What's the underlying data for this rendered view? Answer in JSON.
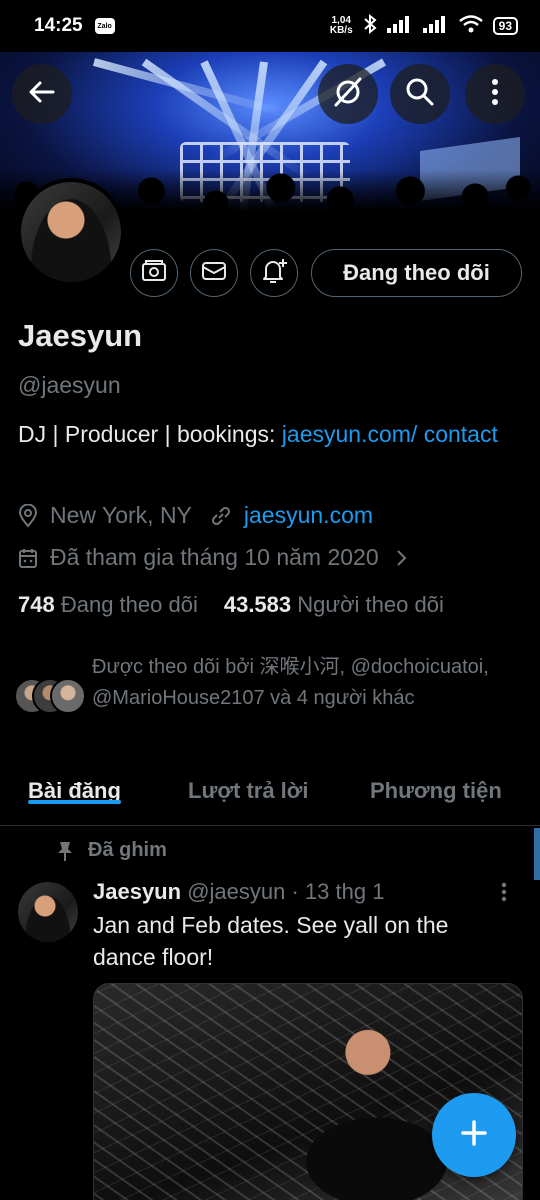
{
  "status_bar": {
    "time": "14:25",
    "notification_app": "Zalo",
    "net_speed_value": "1,04",
    "net_speed_unit": "KB/s",
    "battery": "93"
  },
  "header": {
    "back_icon": "arrow-left-icon",
    "grok_icon": "grok-icon",
    "search_icon": "search-icon",
    "more_icon": "more-vertical-icon"
  },
  "profile": {
    "name": "Jaesyun",
    "handle": "@jaesyun",
    "bio_text": "DJ | Producer | bookings: ",
    "bio_link": "jaesyun.com/ contact",
    "location": "New York, NY",
    "website": "jaesyun.com",
    "joined": "Đã tham gia tháng 10 năm 2020",
    "following_count": "748",
    "following_label": "Đang theo dõi",
    "followers_count": "43.583",
    "followers_label": "Người theo dõi",
    "followed_by": "Được theo dõi bởi 深喉小河, @dochoicuatoi, @MarioHouse2107 và 4 người khác",
    "follow_button": "Đang theo dõi"
  },
  "tabs": [
    {
      "label": "Bài đăng",
      "active": true
    },
    {
      "label": "Lượt trả lời",
      "active": false
    },
    {
      "label": "Phương tiện",
      "active": false
    }
  ],
  "tweet": {
    "pinned_label": "Đã ghim",
    "author": "Jaesyun",
    "handle": "@jaesyun",
    "time": "· 13 thg 1",
    "text": "Jan and Feb dates. See yall on the dance floor!"
  },
  "colors": {
    "accent": "#1d9bf0",
    "background": "#000000",
    "secondary_text": "#71767b",
    "border": "#2f3336"
  }
}
